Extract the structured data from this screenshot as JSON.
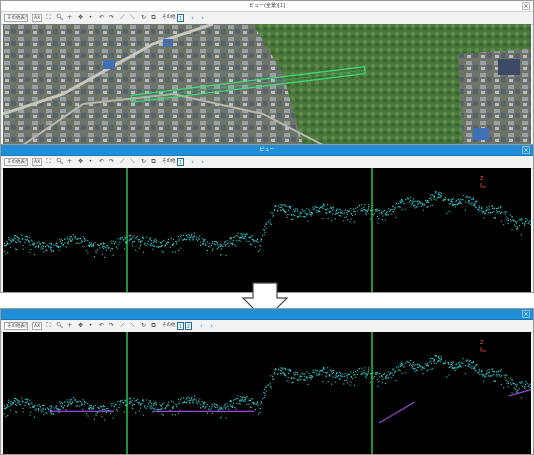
{
  "top_window": {
    "title": "ビュー(全景)[1]",
    "close_label": "×",
    "toolbar": {
      "view_select": "その他表示",
      "view_select2": "AX",
      "scale_label": "その他",
      "page_1": "1",
      "prev": "‹",
      "next": "›"
    }
  },
  "mid_window": {
    "title": "ビュー",
    "close_label": "×",
    "toolbar": {
      "view_select": "その他表示",
      "view_select2": "AX",
      "scale_label": "その他",
      "page_1": "1",
      "prev": "‹",
      "next": "›"
    },
    "axis_marker": "Z"
  },
  "bottom_window": {
    "title": "",
    "close_label": "×",
    "toolbar": {
      "view_select": "その他表示",
      "view_select2": "AX",
      "scale_label": "その他",
      "page_1": "1",
      "page_2": "2",
      "prev": "‹",
      "next": "›"
    },
    "axis_marker": "Z"
  },
  "icons": [
    "search-icon",
    "crosshair-icon",
    "pan-icon",
    "dot-icon",
    "undo-icon",
    "redo-icon",
    "line-icon",
    "rotate-icon",
    "frame-icon"
  ],
  "colors": {
    "point_cloud": "#34d3d3",
    "ground_classified": "#a04ce0",
    "section_line": "#27c34a",
    "highlight_strip": "#35e07a",
    "flow_arrow_fill": "#ffffff",
    "flow_arrow_stroke": "#444444"
  }
}
